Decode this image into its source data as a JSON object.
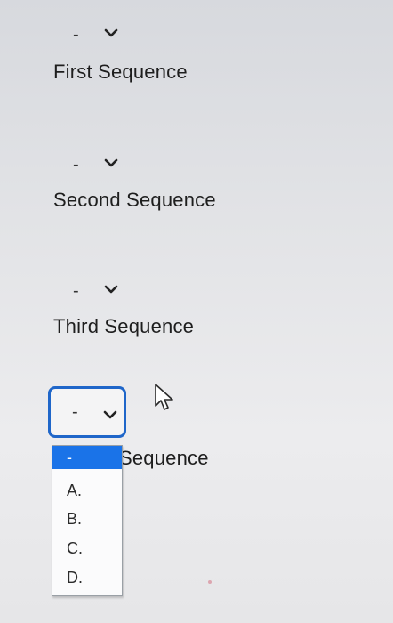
{
  "selects": [
    {
      "value": "-",
      "label": "First Sequence"
    },
    {
      "value": "-",
      "label": "Second Sequence"
    },
    {
      "value": "-",
      "label": "Third Sequence"
    },
    {
      "value": "-",
      "label": "Sequence"
    }
  ],
  "dropdown": {
    "selected_option": "-",
    "options": [
      "A.",
      "B.",
      "C.",
      "D."
    ]
  },
  "colors": {
    "focus_border": "#1f66c9",
    "selected_highlight": "#1a73e8"
  },
  "icons": {
    "chevron": "chevron-down-icon",
    "cursor": "mouse-pointer-icon"
  }
}
